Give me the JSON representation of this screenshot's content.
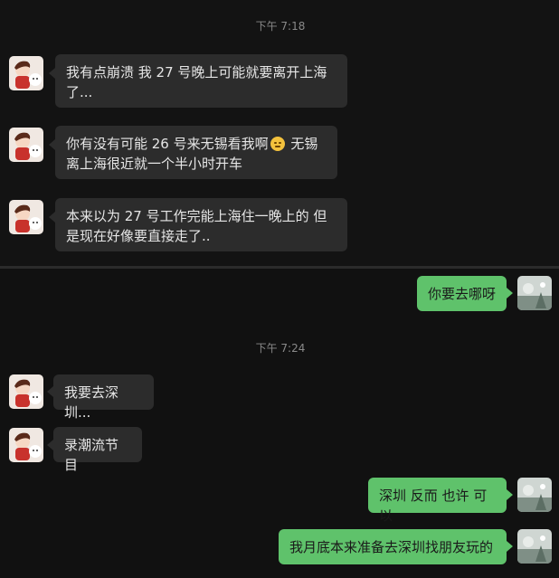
{
  "conversation": {
    "timestamps": [
      "下午 7:18",
      "下午 7:24"
    ],
    "messages": [
      {
        "id": 1,
        "side": "in",
        "text_line1": "我有点崩溃 我 27 号晚上可能就要离开上海",
        "text_line2": "了..."
      },
      {
        "id": 2,
        "side": "in",
        "text_before_emoji": "你有没有可能 26 号来无锡看我啊",
        "emoji": "smiling-face-emoji",
        "text_after_emoji": " 无锡",
        "text_line2": "离上海很近就一个半小时开车"
      },
      {
        "id": 3,
        "side": "in",
        "text_line1": "本来以为 27 号工作完能上海住一晚上的 但",
        "text_line2": "是现在好像要直接走了.."
      },
      {
        "id": 4,
        "side": "out",
        "text": "你要去哪呀"
      },
      {
        "id": 5,
        "side": "in",
        "text": "我要去深圳..."
      },
      {
        "id": 6,
        "side": "in",
        "text": "录潮流节目"
      },
      {
        "id": 7,
        "side": "out",
        "text": "深圳 反而 也许 可以"
      },
      {
        "id": 8,
        "side": "out",
        "text": "我月底本来准备去深圳找朋友玩的"
      }
    ]
  },
  "avatars": {
    "contact": "cartoon-avatar-icon",
    "self": "photo-avatar-icon"
  },
  "colors": {
    "background": "#111111",
    "incoming_bubble": "#2c2c2c",
    "outgoing_bubble": "#5fc26b",
    "timestamp_text": "#8a8a8a"
  }
}
